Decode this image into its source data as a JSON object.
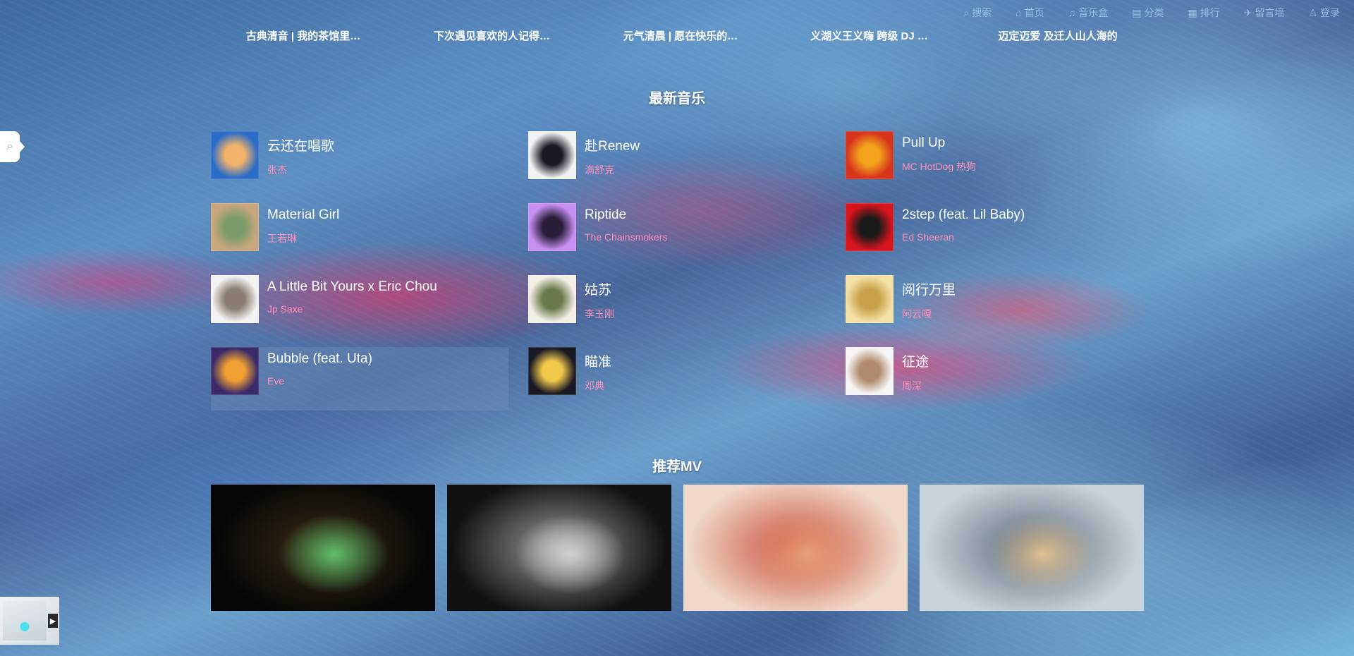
{
  "nav": {
    "items": [
      {
        "icon": "search-icon",
        "glyph": "⌕",
        "label": "搜索"
      },
      {
        "icon": "home-icon",
        "glyph": "⌂",
        "label": "首页"
      },
      {
        "icon": "playlist-icon",
        "glyph": "♫",
        "label": "音乐盒"
      },
      {
        "icon": "category-icon",
        "glyph": "▤",
        "label": "分类"
      },
      {
        "icon": "grid-icon",
        "glyph": "▦",
        "label": "排行"
      },
      {
        "icon": "message-icon",
        "glyph": "✈",
        "label": "留言墙"
      },
      {
        "icon": "user-icon",
        "glyph": "♙",
        "label": "登录"
      }
    ]
  },
  "ticker": [
    "古典清音 | 我的茶馆里…",
    "下次遇见喜欢的人记得…",
    "元气清晨 | 愿在快乐的…",
    "义湖义王义嗨 跨级 DJ …",
    "迈定迈爱 及迁人山人海的"
  ],
  "music": {
    "title": "最新音乐",
    "songs": [
      {
        "title": "云还在唱歌",
        "artist": "张杰",
        "colors": [
          "#2b6cc9",
          "#f4b36a"
        ]
      },
      {
        "title": "赴Renew",
        "artist": "满舒克",
        "colors": [
          "#f2f2f2",
          "#1a1a24"
        ]
      },
      {
        "title": "Pull Up",
        "artist": "MC HotDog 热狗",
        "colors": [
          "#d8341c",
          "#f2a31b"
        ]
      },
      {
        "title": "Material Girl",
        "artist": "王若琳",
        "colors": [
          "#c9a77c",
          "#7a9b6a"
        ]
      },
      {
        "title": "Riptide",
        "artist": "The Chainsmokers",
        "colors": [
          "#c78ff2",
          "#2a1f3a"
        ]
      },
      {
        "title": "2step (feat. Lil Baby)",
        "artist": "Ed Sheeran",
        "colors": [
          "#d8141c",
          "#1a1a1a"
        ]
      },
      {
        "title": "A Little Bit Yours x Eric Chou",
        "artist": "Jp Saxe",
        "colors": [
          "#f3f3f3",
          "#8a7d70"
        ]
      },
      {
        "title": "姑苏",
        "artist": "李玉刚",
        "colors": [
          "#f2efe6",
          "#6b7a4a"
        ]
      },
      {
        "title": "阅行万里",
        "artist": "阿云嘎",
        "colors": [
          "#f3e0a4",
          "#c8a14a"
        ]
      },
      {
        "title": "Bubble (feat. Uta)",
        "artist": "Eve",
        "colors": [
          "#3a2a6a",
          "#f0a030"
        ]
      },
      {
        "title": "瞄准",
        "artist": "邓典",
        "colors": [
          "#1a1a24",
          "#f2c84b"
        ]
      },
      {
        "title": "征途",
        "artist": "周深",
        "colors": [
          "#f5f5f5",
          "#b08a6a"
        ]
      }
    ],
    "active_index": 9
  },
  "mv": {
    "title": "推荐MV",
    "items": [
      {
        "colors": [
          "#070707",
          "#3a2a12",
          "#5fbf6a"
        ]
      },
      {
        "colors": [
          "#111111",
          "#9a9a9a",
          "#d0d0d0"
        ]
      },
      {
        "colors": [
          "#f0d8c8",
          "#c8503a",
          "#e8a07a"
        ]
      },
      {
        "colors": [
          "#c9d2da",
          "#5a6a7a",
          "#e0c090"
        ]
      }
    ]
  }
}
